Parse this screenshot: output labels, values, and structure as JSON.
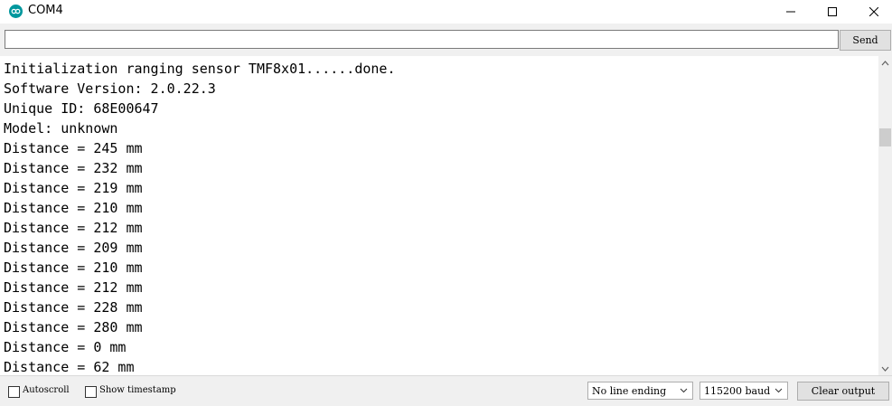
{
  "window": {
    "title": "COM4",
    "icon": "arduino-infinity-icon",
    "controls": [
      "minimize-icon",
      "maximize-icon",
      "close-icon"
    ]
  },
  "send_row": {
    "input_value": "",
    "send_label": "Send"
  },
  "output": {
    "lines": [
      "Initialization ranging sensor TMF8x01......done.",
      "Software Version: 2.0.22.3",
      "Unique ID: 68E00647",
      "Model: unknown",
      "Distance = 245 mm",
      "Distance = 232 mm",
      "Distance = 219 mm",
      "Distance = 210 mm",
      "Distance = 212 mm",
      "Distance = 209 mm",
      "Distance = 210 mm",
      "Distance = 212 mm",
      "Distance = 228 mm",
      "Distance = 280 mm",
      "Distance = 0 mm",
      "Distance = 62 mm"
    ]
  },
  "bottom": {
    "autoscroll_label": "Autoscroll",
    "autoscroll_checked": false,
    "timestamp_label": "Show timestamp",
    "timestamp_checked": false,
    "line_ending": "No line ending",
    "baud": "115200 baud",
    "clear_label": "Clear output"
  },
  "colors": {
    "icon_teal": "#00979d",
    "toolbar_bg": "#f0f0f0"
  }
}
